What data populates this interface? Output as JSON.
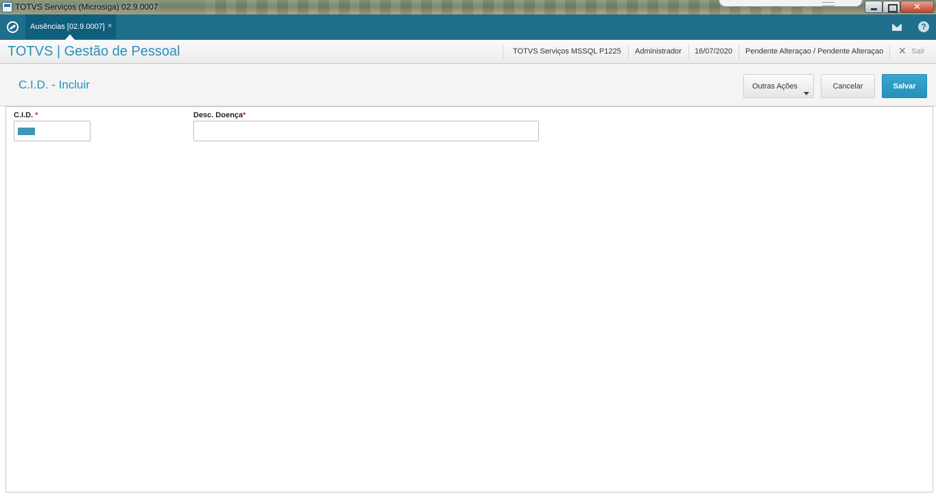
{
  "window": {
    "title": "TOTVS Serviços (Microsiga) 02.9.0007",
    "close_glyph": "✕"
  },
  "appbar": {
    "tab_label": "Ausências [02.9.0007]",
    "tab_close": "×",
    "help_glyph": "?"
  },
  "module": {
    "title": "TOTVS | Gestão de Pessoal",
    "environment": "TOTVS Serviços MSSQL P1225",
    "user": "Administrador",
    "date": "16/07/2020",
    "status": "Pendente Alteraçao / Pendente Alteraçao",
    "exit_icon": "✕",
    "exit_label": "Sair"
  },
  "page": {
    "title": "C.I.D. - Incluir",
    "buttons": {
      "outras": "Outras Ações",
      "cancelar": "Cancelar",
      "salvar": "Salvar"
    }
  },
  "form": {
    "cid_label": "C.I.D.",
    "cid_required": " *",
    "cid_value": "",
    "desc_label": "Desc. Doença",
    "desc_required": "*",
    "desc_value": ""
  },
  "colors": {
    "appbar": "#1f6f8c",
    "accent": "#2a8fbd",
    "primary_button": "#2490bb"
  }
}
